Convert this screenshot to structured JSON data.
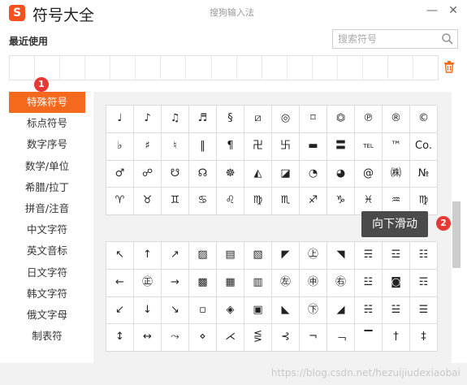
{
  "app": {
    "logo": "S",
    "title": "符号大全",
    "ime_name": "搜狗输入法"
  },
  "window": {
    "minimize": "—",
    "close": "✕"
  },
  "recent": {
    "label": "最近使用",
    "cells": 17
  },
  "search": {
    "placeholder": "搜索符号",
    "value": ""
  },
  "sidebar": {
    "items": [
      {
        "label": "特殊符号",
        "active": true
      },
      {
        "label": "标点符号"
      },
      {
        "label": "数字序号"
      },
      {
        "label": "数学/单位"
      },
      {
        "label": "希腊/拉丁"
      },
      {
        "label": "拼音/注音"
      },
      {
        "label": "中文字符"
      },
      {
        "label": "英文音标"
      },
      {
        "label": "日文字符"
      },
      {
        "label": "韩文字符"
      },
      {
        "label": "俄文字母"
      },
      {
        "label": "制表符"
      }
    ]
  },
  "annotations": {
    "badge1": "1",
    "badge2": "2",
    "tooltip": "向下滑动"
  },
  "grid1": [
    "♩",
    "♪",
    "♫",
    "♬",
    "§",
    "⧄",
    "◎",
    "⌑",
    "⏣",
    "℗",
    "®",
    "©",
    "♭",
    "♯",
    "♮",
    "‖",
    "¶",
    "卍",
    "卐",
    "▬",
    "〓",
    "TEL",
    "™",
    "Co.",
    "♂",
    "☍",
    "☋",
    "☊",
    "☸",
    "◭",
    "◪",
    "◔",
    "◕",
    "@",
    "㈱",
    "№",
    "♈",
    "♉",
    "♊",
    "♋",
    "♌",
    "♍",
    "♏",
    "♐",
    "♑",
    "♓",
    "♒",
    "♍"
  ],
  "grid2": [
    "↖",
    "↑",
    "↗",
    "▨",
    "▤",
    "▧",
    "◤",
    "㊤",
    "◥",
    "☴",
    "☲",
    "☷",
    "←",
    "㊣",
    "→",
    "▩",
    "▦",
    "▥",
    "㊧",
    "㊥",
    "㊨",
    "☳",
    "◙",
    "☶",
    "↙",
    "↓",
    "↘",
    "▫",
    "◈",
    "▣",
    "◣",
    "㊦",
    "◢",
    "☵",
    "☱",
    "☰",
    "↕",
    "↔",
    "⤳",
    "⋄",
    "⋌",
    "⋚",
    "⊰",
    "¬",
    "﹁",
    "▔",
    "†",
    "‡"
  ],
  "watermark": "https://blog.csdn.net/hezuijiudexiaobai",
  "colors": {
    "accent": "#f4691e",
    "badge": "#e53935",
    "tooltip_bg": "#4a4a4a"
  }
}
